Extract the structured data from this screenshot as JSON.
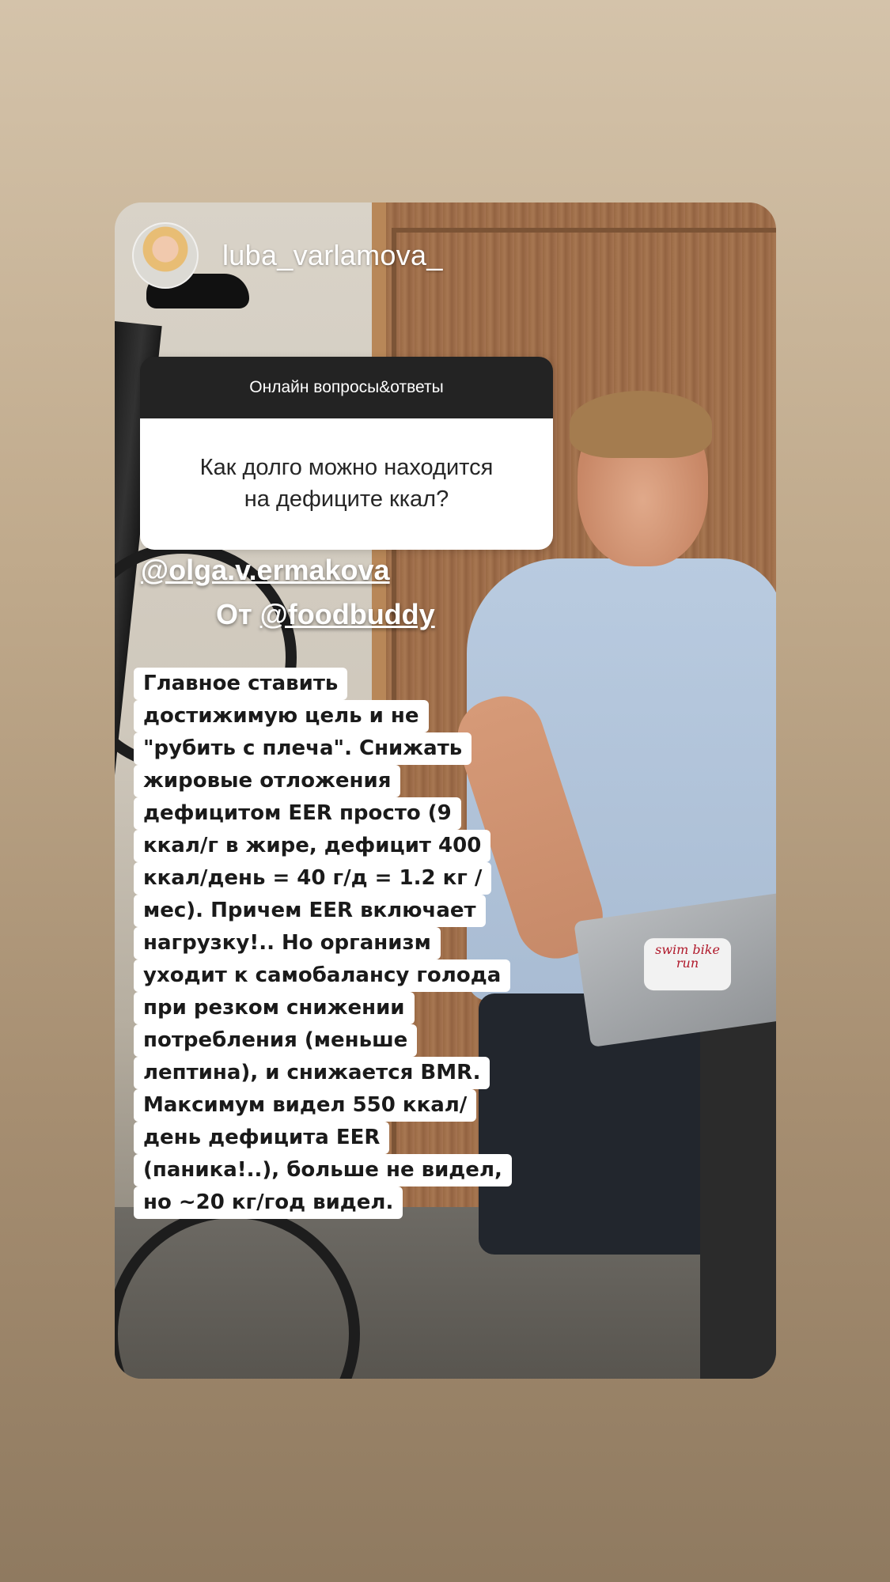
{
  "story": {
    "username": "luba_varlamova_",
    "question": {
      "header": "Онлайн вопросы&ответы",
      "line1": "Как долго можно находится",
      "line2": "на дефиците ккал?"
    },
    "mention1": "@olga.v.ermakova",
    "mention2_prefix": "От ",
    "mention2_link": "@foodbuddy",
    "answer_lines": [
      "Главное ставить",
      "достижимую цель и не",
      "\"рубить с плеча\". Снижать",
      "жировые отложения",
      "дефицитом EER просто (9",
      "ккал/г в жире, дефицит 400",
      "ккал/день = 40 г/д = 1.2 кг /",
      "мес). Причем EER включает",
      "нагрузку!.. Но организм",
      "уходит к самобалансу голода",
      "при резком снижении",
      "потребления (меньше",
      "лептина), и снижается BMR.",
      "Максимум видел 550 ккал/",
      "день дефицита EER",
      "(паника!..), больше не видел,",
      "но ~20 кг/год видел."
    ],
    "sticker_text": "swim bike run"
  }
}
